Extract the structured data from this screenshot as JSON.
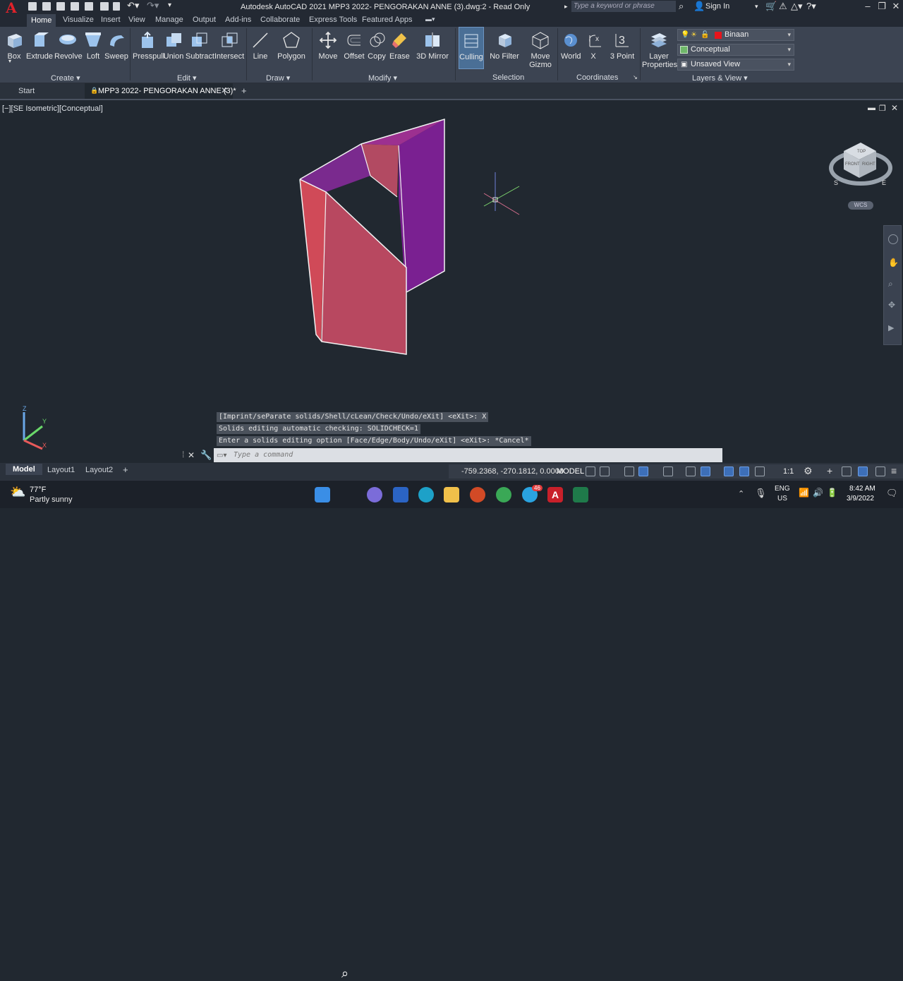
{
  "titlebar": {
    "app_logo": "A",
    "title": "Autodesk AutoCAD 2021    MPP3 2022- PENGORAKAN ANNE (3).dwg:2 - Read Only",
    "search_placeholder": "Type a keyword or phrase",
    "sign_in": "Sign In"
  },
  "menu_tabs": [
    "Home",
    "Visualize",
    "Insert",
    "View",
    "Manage",
    "Output",
    "Add-ins",
    "Collaborate",
    "Express Tools",
    "Featured Apps"
  ],
  "ribbon": {
    "create": {
      "title": "Create",
      "tools": [
        "Box",
        "Extrude",
        "Revolve",
        "Loft",
        "Sweep"
      ]
    },
    "edit": {
      "title": "Edit",
      "tools": [
        "Presspull",
        "Union",
        "Subtract",
        "Intersect"
      ]
    },
    "draw": {
      "title": "Draw",
      "tools": [
        "Line",
        "Polygon"
      ]
    },
    "modify": {
      "title": "Modify",
      "tools": [
        "Move",
        "Offset",
        "Copy",
        "Erase",
        "3D Mirror"
      ]
    },
    "selection": {
      "title": "Selection",
      "tools": [
        "Culling",
        "No Filter",
        "Move",
        "Gizmo"
      ]
    },
    "coordinates": {
      "title": "Coordinates",
      "tools": [
        "World",
        "X",
        "3 Point"
      ]
    },
    "layers_view": {
      "title": "Layers & View",
      "layer_props_1": "Layer",
      "layer_props_2": "Properties",
      "layer": "Binaan",
      "visual_style": "Conceptual",
      "view": "Unsaved View"
    }
  },
  "file_tabs": {
    "start": "Start",
    "doc": "MPP3 2022- PENGORAKAN ANNE (3)*"
  },
  "viewport": {
    "label": "[−][SE Isometric][Conceptual]",
    "viewcube": {
      "top": "TOP",
      "front": "FRONT",
      "right": "RIGHT",
      "s": "S",
      "e": "E",
      "wcs": "WCS"
    }
  },
  "command_history": [
    "[Imprint/seParate solids/Shell/cLean/Check/Undo/eXit] <eXit>: X",
    "Solids editing automatic checking:  SOLIDCHECK=1",
    "Enter a solids editing option [Face/Edge/Body/Undo/eXit] <eXit>: *Cancel*"
  ],
  "command_placeholder": "Type a command",
  "statusbar": {
    "layout_tabs": [
      "Model",
      "Layout1",
      "Layout2"
    ],
    "coords": "-759.2368, -270.1812, 0.0000",
    "model": "MODEL",
    "scale": "1:1"
  },
  "taskbar": {
    "temperature": "77°F",
    "condition": "Partly sunny",
    "lang1": "ENG",
    "lang2": "US",
    "time": "8:42 AM",
    "date": "3/9/2022",
    "notif_badge": "46"
  }
}
